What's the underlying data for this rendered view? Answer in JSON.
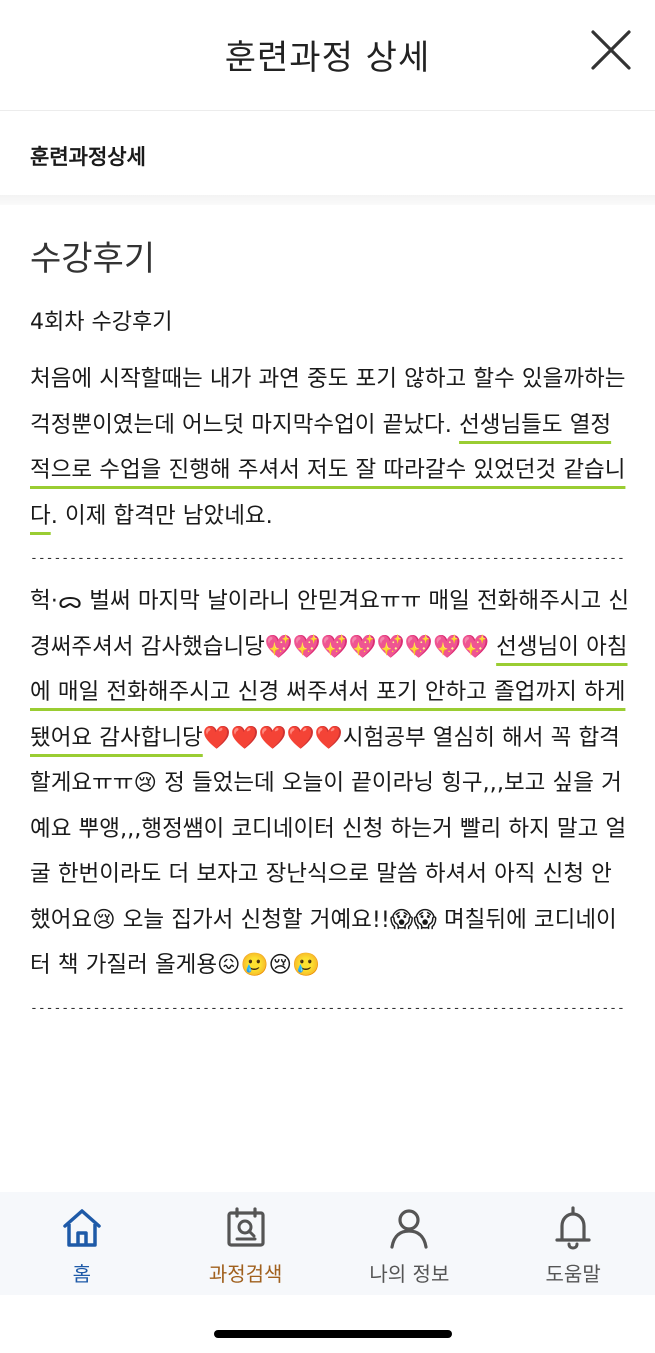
{
  "header": {
    "title": "훈련과정 상세"
  },
  "section": {
    "label": "훈련과정상세"
  },
  "review": {
    "heading": "수강후기",
    "subtitle": "4회차 수강후기",
    "para1_plain": "처음에 시작할때는 내가 과연 중도 포기 않하고 할수 있을까하는 걱정뿐이였는데 어느덧 마지막수업이 끝났다. ",
    "para1_highlight": "선생님들도 열정적으로 수업을 진행해 주셔서 저도 잘 따라갈수 있었던것 같습니다",
    "para1_tail": ". 이제 합격만 남았네요.",
    "divider": "----------------------------------------------------------------------------------------",
    "para2_plain": "헉·ᯅ 벌써 마지막 날이라니 안믿겨요ㅠㅠ 매일 전화해주시고 신경써주셔서 감사했습니당💖💖💖💖💖💖💖💖 ",
    "para2_highlight": "선생님이 아침에 매일 전화해주시고 신경 써주셔서 포기 안하고 졸업까지 하게 됐어요 감사합니당",
    "para2_tail": "❤️❤️❤️❤️❤️시험공부 열심히 해서 꼭 합격 할게요ㅠㅠ😢 정 들었는데 오늘이 끝이라닝 힝구,,,보고 싶을 거예요 뿌앵,,,행정쌤이 코디네이터 신청 하는거 빨리 하지 말고 얼굴 한번이라도 더 보자고 장난식으로 말씀 하셔서 아직 신청 안했어요😢 오늘 집가서 신청할 거예요!!😱😱 며칠뒤에 코디네이터 책 가질러 올게용😖🥲😢🥲",
    "divider2": "----------------------------------------------------------------------------------------"
  },
  "nav": {
    "items": [
      {
        "label": "홈",
        "icon": "home-icon"
      },
      {
        "label": "과정검색",
        "icon": "search-course-icon"
      },
      {
        "label": "나의 정보",
        "icon": "user-icon"
      },
      {
        "label": "도움말",
        "icon": "bell-icon"
      }
    ],
    "active_color": "#1e5aa8",
    "highlight_color": "#a0601e",
    "default_color": "#555555"
  },
  "colors": {
    "underline": "#9acd32"
  }
}
